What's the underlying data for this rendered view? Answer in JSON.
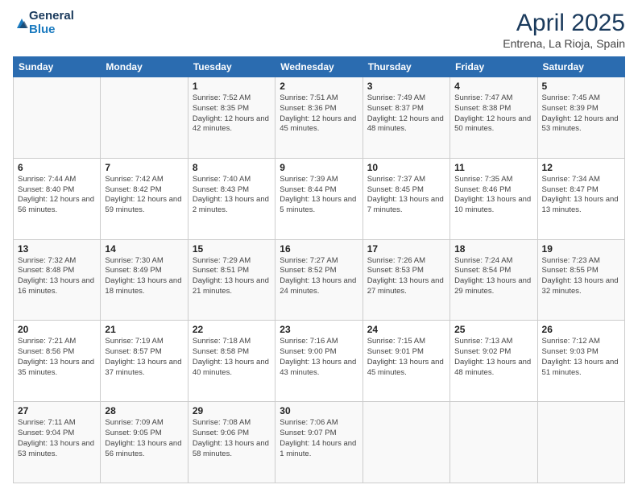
{
  "header": {
    "logo_line1": "General",
    "logo_line2": "Blue",
    "title": "April 2025",
    "subtitle": "Entrena, La Rioja, Spain"
  },
  "columns": [
    "Sunday",
    "Monday",
    "Tuesday",
    "Wednesday",
    "Thursday",
    "Friday",
    "Saturday"
  ],
  "weeks": [
    [
      {
        "day": "",
        "info": ""
      },
      {
        "day": "",
        "info": ""
      },
      {
        "day": "1",
        "info": "Sunrise: 7:52 AM\nSunset: 8:35 PM\nDaylight: 12 hours and 42 minutes."
      },
      {
        "day": "2",
        "info": "Sunrise: 7:51 AM\nSunset: 8:36 PM\nDaylight: 12 hours and 45 minutes."
      },
      {
        "day": "3",
        "info": "Sunrise: 7:49 AM\nSunset: 8:37 PM\nDaylight: 12 hours and 48 minutes."
      },
      {
        "day": "4",
        "info": "Sunrise: 7:47 AM\nSunset: 8:38 PM\nDaylight: 12 hours and 50 minutes."
      },
      {
        "day": "5",
        "info": "Sunrise: 7:45 AM\nSunset: 8:39 PM\nDaylight: 12 hours and 53 minutes."
      }
    ],
    [
      {
        "day": "6",
        "info": "Sunrise: 7:44 AM\nSunset: 8:40 PM\nDaylight: 12 hours and 56 minutes."
      },
      {
        "day": "7",
        "info": "Sunrise: 7:42 AM\nSunset: 8:42 PM\nDaylight: 12 hours and 59 minutes."
      },
      {
        "day": "8",
        "info": "Sunrise: 7:40 AM\nSunset: 8:43 PM\nDaylight: 13 hours and 2 minutes."
      },
      {
        "day": "9",
        "info": "Sunrise: 7:39 AM\nSunset: 8:44 PM\nDaylight: 13 hours and 5 minutes."
      },
      {
        "day": "10",
        "info": "Sunrise: 7:37 AM\nSunset: 8:45 PM\nDaylight: 13 hours and 7 minutes."
      },
      {
        "day": "11",
        "info": "Sunrise: 7:35 AM\nSunset: 8:46 PM\nDaylight: 13 hours and 10 minutes."
      },
      {
        "day": "12",
        "info": "Sunrise: 7:34 AM\nSunset: 8:47 PM\nDaylight: 13 hours and 13 minutes."
      }
    ],
    [
      {
        "day": "13",
        "info": "Sunrise: 7:32 AM\nSunset: 8:48 PM\nDaylight: 13 hours and 16 minutes."
      },
      {
        "day": "14",
        "info": "Sunrise: 7:30 AM\nSunset: 8:49 PM\nDaylight: 13 hours and 18 minutes."
      },
      {
        "day": "15",
        "info": "Sunrise: 7:29 AM\nSunset: 8:51 PM\nDaylight: 13 hours and 21 minutes."
      },
      {
        "day": "16",
        "info": "Sunrise: 7:27 AM\nSunset: 8:52 PM\nDaylight: 13 hours and 24 minutes."
      },
      {
        "day": "17",
        "info": "Sunrise: 7:26 AM\nSunset: 8:53 PM\nDaylight: 13 hours and 27 minutes."
      },
      {
        "day": "18",
        "info": "Sunrise: 7:24 AM\nSunset: 8:54 PM\nDaylight: 13 hours and 29 minutes."
      },
      {
        "day": "19",
        "info": "Sunrise: 7:23 AM\nSunset: 8:55 PM\nDaylight: 13 hours and 32 minutes."
      }
    ],
    [
      {
        "day": "20",
        "info": "Sunrise: 7:21 AM\nSunset: 8:56 PM\nDaylight: 13 hours and 35 minutes."
      },
      {
        "day": "21",
        "info": "Sunrise: 7:19 AM\nSunset: 8:57 PM\nDaylight: 13 hours and 37 minutes."
      },
      {
        "day": "22",
        "info": "Sunrise: 7:18 AM\nSunset: 8:58 PM\nDaylight: 13 hours and 40 minutes."
      },
      {
        "day": "23",
        "info": "Sunrise: 7:16 AM\nSunset: 9:00 PM\nDaylight: 13 hours and 43 minutes."
      },
      {
        "day": "24",
        "info": "Sunrise: 7:15 AM\nSunset: 9:01 PM\nDaylight: 13 hours and 45 minutes."
      },
      {
        "day": "25",
        "info": "Sunrise: 7:13 AM\nSunset: 9:02 PM\nDaylight: 13 hours and 48 minutes."
      },
      {
        "day": "26",
        "info": "Sunrise: 7:12 AM\nSunset: 9:03 PM\nDaylight: 13 hours and 51 minutes."
      }
    ],
    [
      {
        "day": "27",
        "info": "Sunrise: 7:11 AM\nSunset: 9:04 PM\nDaylight: 13 hours and 53 minutes."
      },
      {
        "day": "28",
        "info": "Sunrise: 7:09 AM\nSunset: 9:05 PM\nDaylight: 13 hours and 56 minutes."
      },
      {
        "day": "29",
        "info": "Sunrise: 7:08 AM\nSunset: 9:06 PM\nDaylight: 13 hours and 58 minutes."
      },
      {
        "day": "30",
        "info": "Sunrise: 7:06 AM\nSunset: 9:07 PM\nDaylight: 14 hours and 1 minute."
      },
      {
        "day": "",
        "info": ""
      },
      {
        "day": "",
        "info": ""
      },
      {
        "day": "",
        "info": ""
      }
    ]
  ]
}
